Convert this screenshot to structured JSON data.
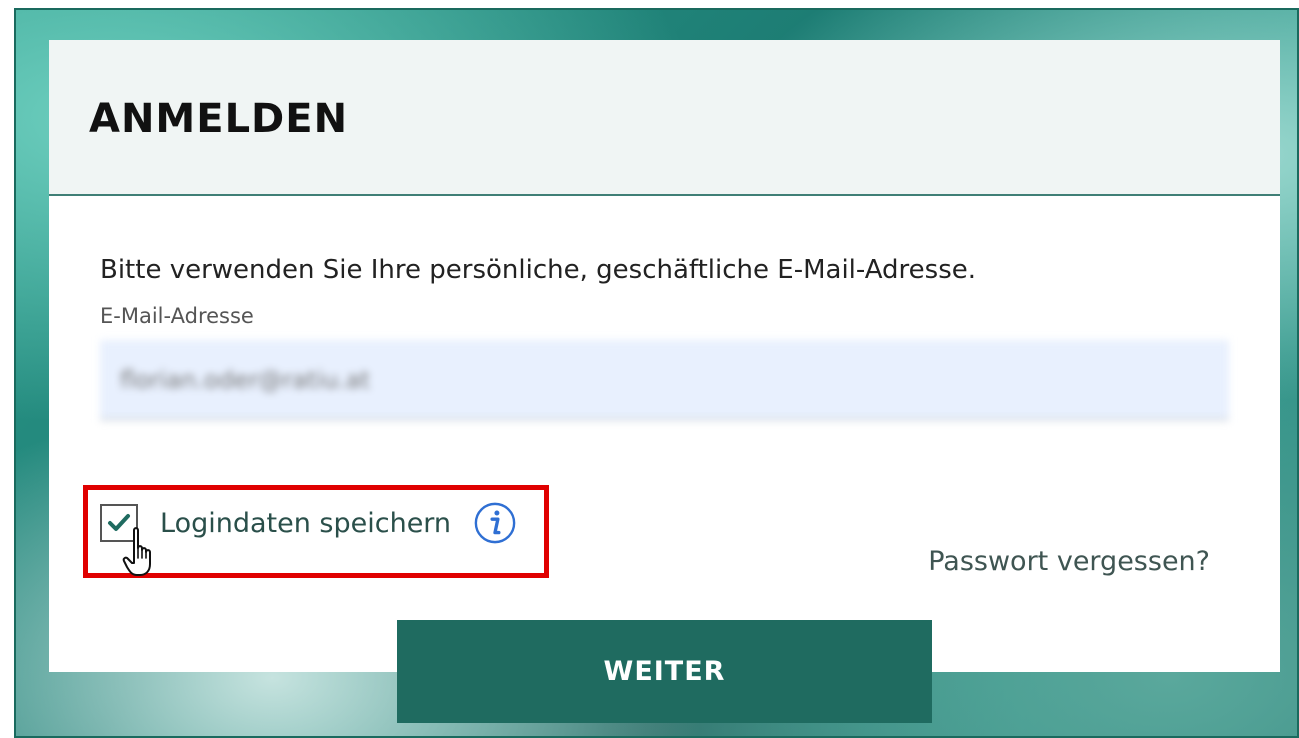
{
  "login": {
    "title": "ANMELDEN",
    "intro": "Bitte verwenden Sie Ihre persönliche, geschäftliche E-Mail-Adresse.",
    "email_label": "E-Mail-Adresse",
    "email_value": "florian.oder@ratiu.at",
    "remember_label": "Logindaten speichern",
    "remember_checked": true,
    "forgot_link": "Passwort vergessen?",
    "submit_label": "WEITER"
  },
  "icons": {
    "checkbox": "checkmark-icon",
    "info": "info-icon",
    "cursor": "hand-pointer-icon"
  },
  "colors": {
    "primary": "#1f6b60",
    "header_bg": "#f0f5f4",
    "input_bg": "#e8f0fe",
    "highlight": "#e00000",
    "info_blue": "#2f6fd3"
  }
}
